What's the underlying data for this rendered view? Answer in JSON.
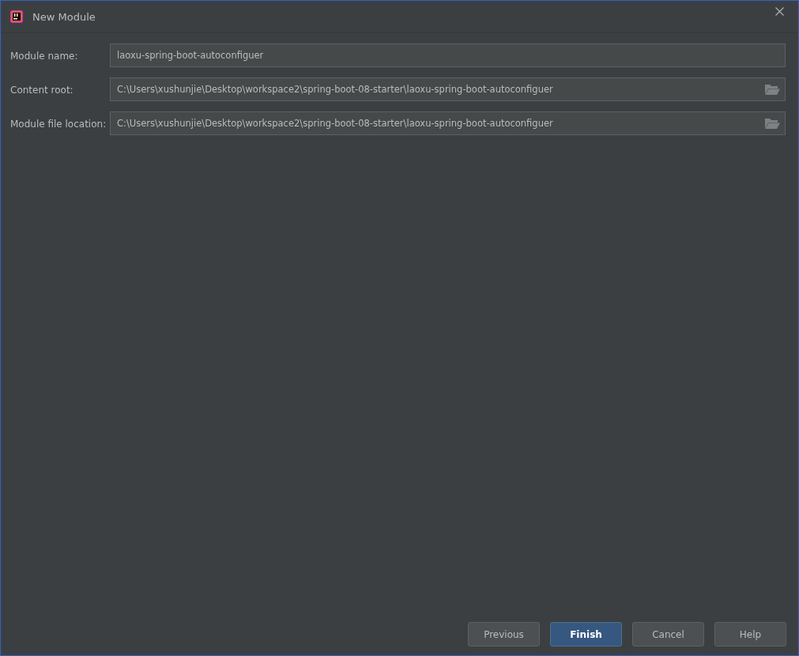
{
  "window": {
    "title": "New Module"
  },
  "fields": [
    {
      "label": "Module name:",
      "value": "laoxu-spring-boot-autoconfiguer",
      "browse": false
    },
    {
      "label": "Content root:",
      "value": "C:\\Users\\xushunjie\\Desktop\\workspace2\\spring-boot-08-starter\\laoxu-spring-boot-autoconfiguer",
      "browse": true
    },
    {
      "label": "Module file location:",
      "value": "C:\\Users\\xushunjie\\Desktop\\workspace2\\spring-boot-08-starter\\laoxu-spring-boot-autoconfiguer",
      "browse": true
    }
  ],
  "buttons": [
    {
      "label": "Previous",
      "primary": false
    },
    {
      "label": "Finish",
      "primary": true
    },
    {
      "label": "Cancel",
      "primary": false
    },
    {
      "label": "Help",
      "primary": false
    }
  ]
}
